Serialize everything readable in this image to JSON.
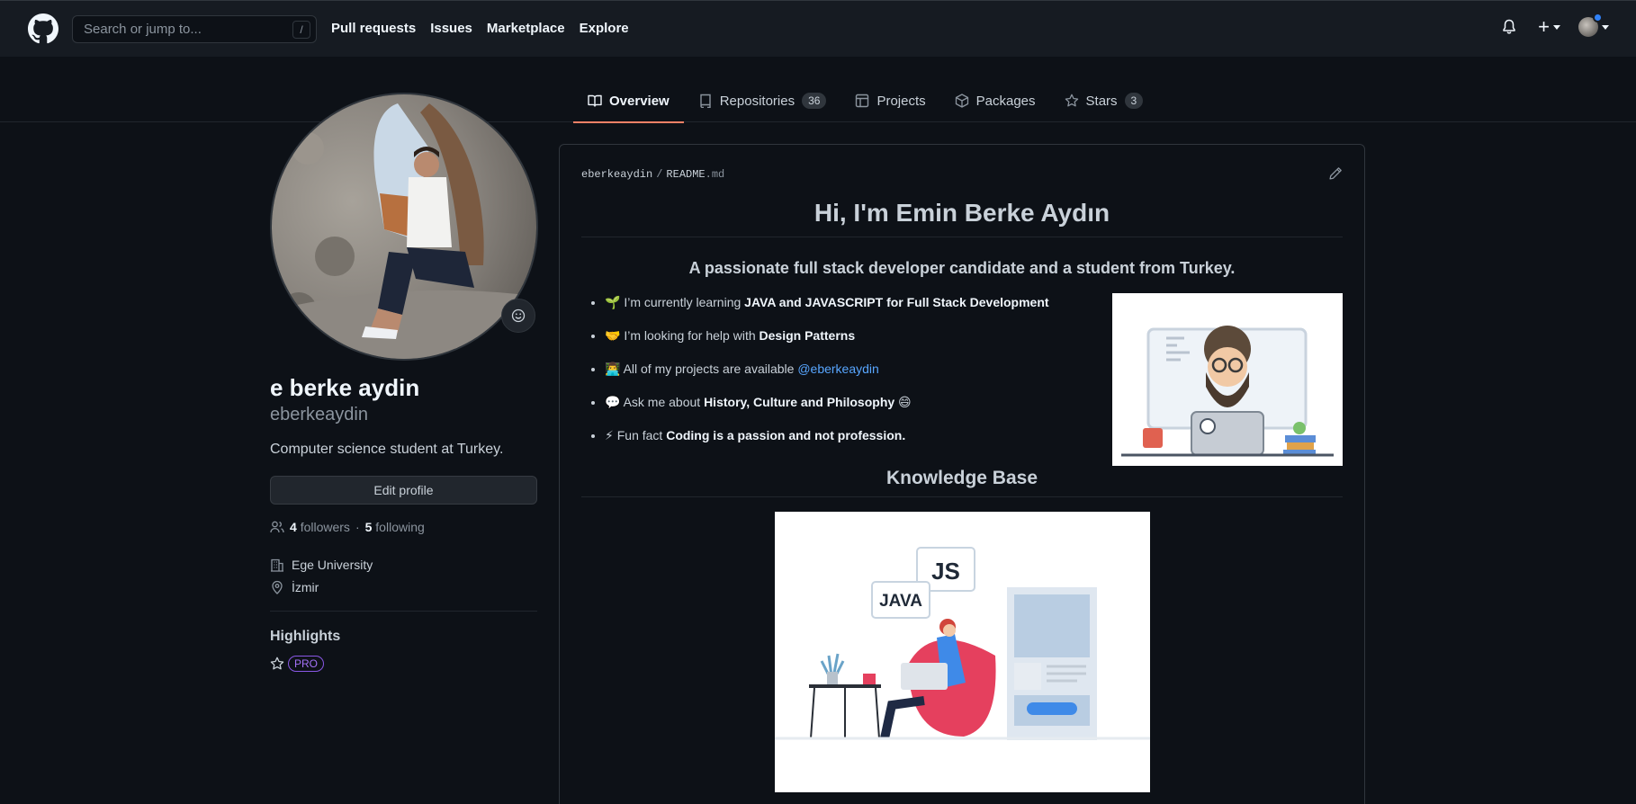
{
  "header": {
    "search_placeholder": "Search or jump to...",
    "search_shortcut": "/",
    "nav": [
      "Pull requests",
      "Issues",
      "Marketplace",
      "Explore"
    ],
    "plus_symbol": "+"
  },
  "tabs": [
    {
      "label": "Overview",
      "icon": "book-icon",
      "selected": true
    },
    {
      "label": "Repositories",
      "icon": "repo-icon",
      "count": "36"
    },
    {
      "label": "Projects",
      "icon": "project-icon"
    },
    {
      "label": "Packages",
      "icon": "package-icon"
    },
    {
      "label": "Stars",
      "icon": "star-icon",
      "count": "3"
    }
  ],
  "profile": {
    "full_name": "e berke aydin",
    "login": "eberkeaydin",
    "bio": "Computer science student at Turkey.",
    "edit_label": "Edit profile",
    "followers_count": "4",
    "followers_label": "followers",
    "following_count": "5",
    "following_label": "following",
    "dot": "·",
    "organization": "Ege University",
    "location": "İzmir",
    "highlights_title": "Highlights",
    "pro_badge": "PRO"
  },
  "readme": {
    "repo": "eberkeaydin",
    "separator": "/",
    "file_name": "README",
    "file_ext": ".md",
    "title": "Hi, I'm Emin Berke Aydın",
    "subtitle": "A passionate full stack developer candidate and a student from Turkey.",
    "bullets": [
      {
        "emoji": "🌱",
        "text": "I’m currently learning ",
        "bold": "JAVA and JAVASCRIPT for Full Stack Development",
        "tail": ""
      },
      {
        "emoji": "🤝",
        "text": "I’m looking for help with ",
        "bold": "Design Patterns",
        "tail": ""
      },
      {
        "emoji": "👨‍💻",
        "text": "All of my projects are available ",
        "link": "@eberkeaydin"
      },
      {
        "emoji": "💬",
        "text": "Ask me about ",
        "bold": "History, Culture and Philosophy",
        "tail": " 😄"
      },
      {
        "emoji": "⚡",
        "text": "Fun fact ",
        "bold": "Coding is a passion and not profession.",
        "tail": ""
      }
    ],
    "section_title": "Knowledge Base",
    "illustration2_labels": [
      "JS",
      "JAVA"
    ]
  },
  "colors": {
    "accent_underline": "#f78166",
    "link": "#58a6ff",
    "pro": "#a371f7"
  }
}
